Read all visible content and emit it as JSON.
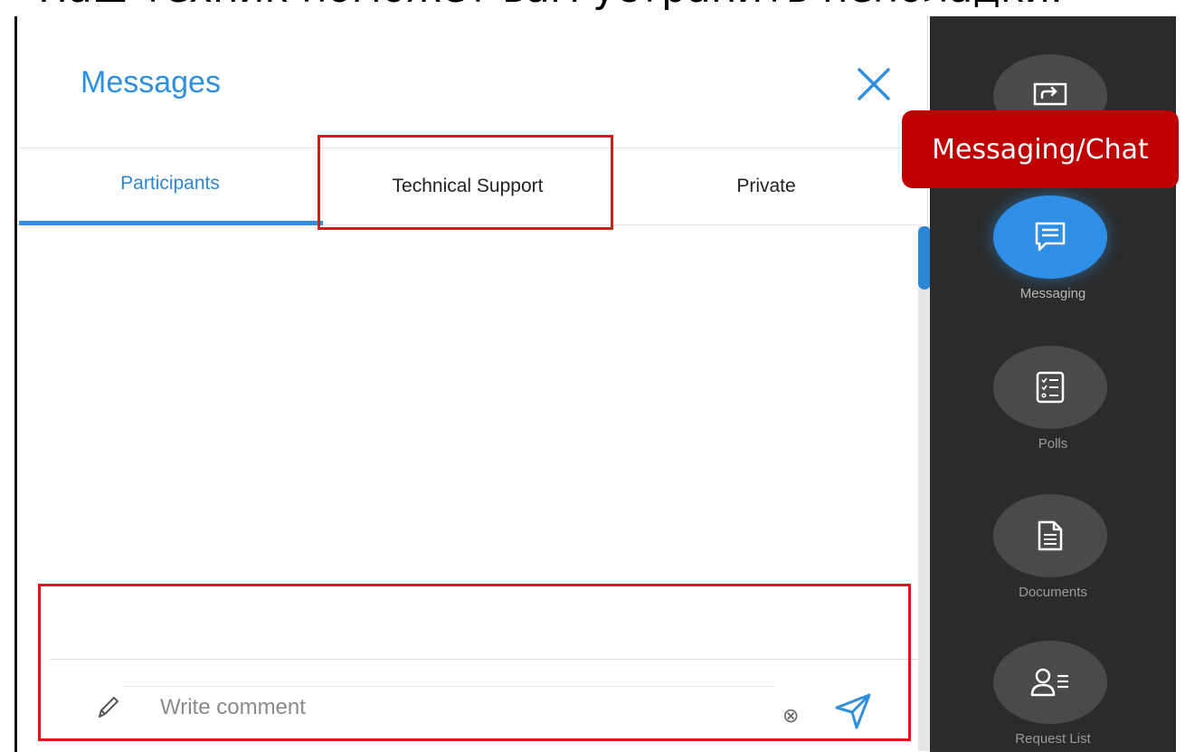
{
  "caption": "Наш техник поможет вам устранить неполадки.",
  "panel": {
    "title": "Messages",
    "tabs": [
      {
        "label": "Participants",
        "active": true
      },
      {
        "label": "Technical Support",
        "active": false
      },
      {
        "label": "Private",
        "active": false
      }
    ],
    "composer": {
      "placeholder": "Write comment",
      "clear_symbol": "⊗"
    }
  },
  "sidebar": {
    "items": [
      {
        "label": "",
        "icon": "screen-share-icon"
      },
      {
        "label": "Messaging",
        "icon": "chat-icon",
        "active": true
      },
      {
        "label": "Polls",
        "icon": "poll-icon"
      },
      {
        "label": "Documents",
        "icon": "document-icon"
      },
      {
        "label": "Request List",
        "icon": "request-list-icon"
      }
    ]
  },
  "tooltip": {
    "text": "Messaging/Chat"
  },
  "colors": {
    "accent": "#2f8fdc",
    "highlight": "#e0151b",
    "tooltip_bg": "#c00000",
    "sidebar_bg": "#2b2b2b"
  }
}
